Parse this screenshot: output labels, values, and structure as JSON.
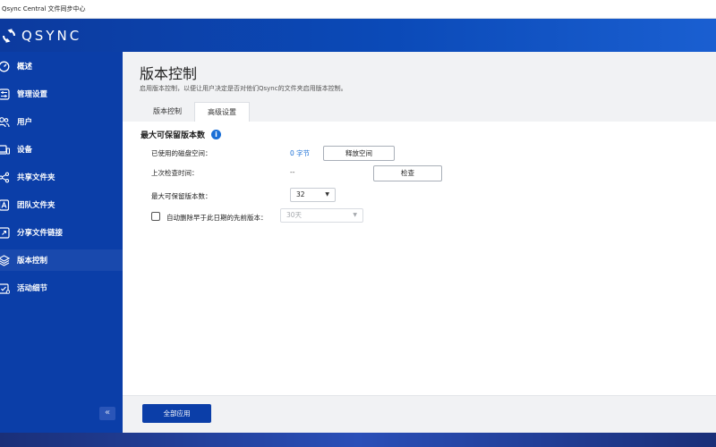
{
  "window": {
    "title": "Qsync Central 文件同步中心"
  },
  "app": {
    "logo_text": "QSYNC"
  },
  "sidebar": {
    "items": [
      {
        "label": "概述",
        "icon": "dashboard-icon"
      },
      {
        "label": "管理设置",
        "icon": "sliders-icon"
      },
      {
        "label": "用户",
        "icon": "users-icon"
      },
      {
        "label": "设备",
        "icon": "devices-icon"
      },
      {
        "label": "共享文件夹",
        "icon": "share-folder-icon"
      },
      {
        "label": "团队文件夹",
        "icon": "team-folder-icon"
      },
      {
        "label": "分享文件链接",
        "icon": "link-icon"
      },
      {
        "label": "版本控制",
        "icon": "layers-icon"
      },
      {
        "label": "活动细节",
        "icon": "activity-icon"
      }
    ],
    "active_index": 7,
    "collapse_label": "«"
  },
  "main": {
    "title": "版本控制",
    "description": "启用版本控制，以便让用户决定是否对他们Qsync的文件夹启用版本控制。",
    "tabs": [
      {
        "label": "版本控制",
        "active": false
      },
      {
        "label": "高级设置",
        "active": true
      }
    ],
    "section": {
      "title": "最大可保留版本数",
      "info_icon": "i",
      "used_space_label": "已使用的磁盘空间：",
      "used_space_value": "0 字节",
      "release_button": "释放空间",
      "last_check_label": "上次检查时间：",
      "last_check_value": "--",
      "check_button": "检查",
      "max_versions_label": "最大可保留版本数：",
      "max_versions_value": "32",
      "auto_delete_label": "自动删除早于此日期的先前版本：",
      "auto_delete_checked": false,
      "auto_delete_value": "30天"
    },
    "apply_button": "全部应用"
  },
  "colors": {
    "sidebar_bg": "#0b3ea8",
    "header_bg": "#0c3a9e",
    "accent": "#1a6fd6",
    "primary_button": "#0b3ea8"
  }
}
